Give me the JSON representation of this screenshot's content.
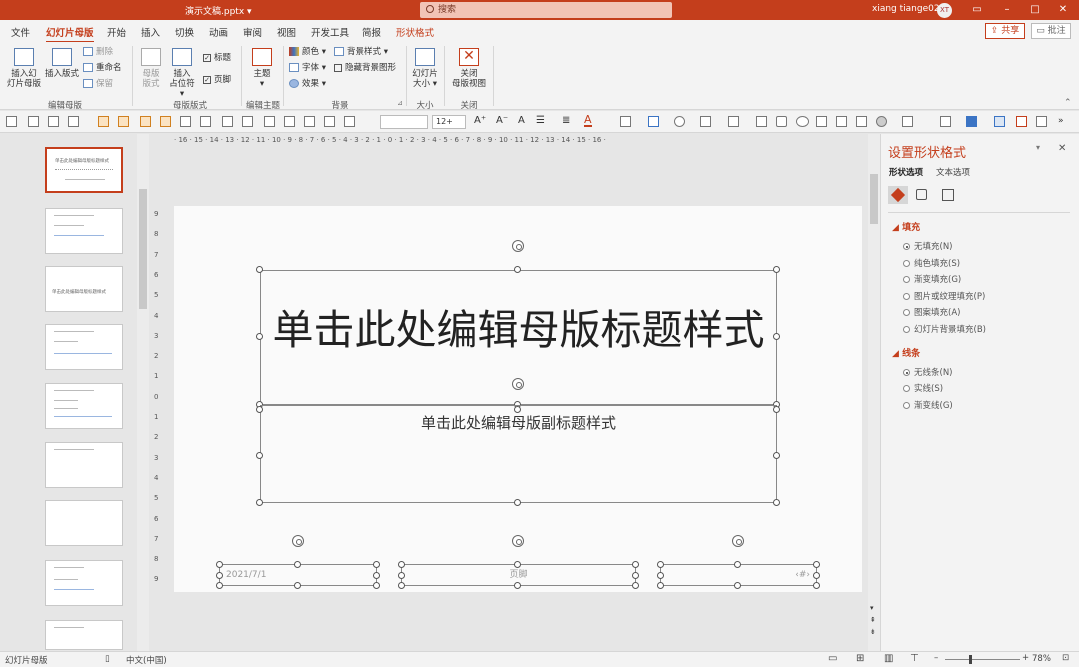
{
  "app": {
    "file_title": "演示文稿.pptx",
    "search_placeholder": "搜索",
    "user_name": "xiang tiange02",
    "user_initials": "XT"
  },
  "menu": {
    "tabs": [
      "文件",
      "幻灯片母版",
      "开始",
      "插入",
      "切换",
      "动画",
      "审阅",
      "视图",
      "开发工具",
      "简报",
      "形状格式"
    ],
    "share": "共享",
    "comment": "批注"
  },
  "ribbon": {
    "insert_master": "插入幻灯片母版",
    "insert_master_l1": "插入幻",
    "insert_master_l2": "灯片母版",
    "insert_layout": "插入版式",
    "delete": "删除",
    "rename": "重命名",
    "preserve": "保留",
    "group_edit_master": "编辑母版",
    "master_layout_l1": "母版",
    "master_layout_l2": "版式",
    "insert_placeholder_l1": "插入",
    "insert_placeholder_l2": "占位符",
    "title_chk": "标题",
    "footer_chk": "页脚",
    "group_master_layout": "母版版式",
    "theme": "主题",
    "group_edit_theme": "编辑主题",
    "colors": "颜色",
    "fonts": "字体",
    "effects": "效果",
    "bg_styles": "背景样式",
    "hide_bg": "隐藏背景图形",
    "group_background": "背景",
    "slide_size_l1": "幻灯片",
    "slide_size_l2": "大小",
    "group_size": "大小",
    "close_l1": "关闭",
    "close_l2": "母版视图",
    "group_close": "关闭"
  },
  "toolbar": {
    "font_size": "12+"
  },
  "rulers": {
    "h": "· 16 · 15 · 14 · 13 · 12 · 11 · 10 · 9 · 8 · 7 · 6 · 5 · 4 · 3 · 2 · 1 · 0 · 1 · 2 · 3 · 4 · 5 · 6 · 7 · 8 · 9 · 10 · 11 · 12 · 13 · 14 · 15 · 16 ·",
    "v": [
      "9",
      "8",
      "7",
      "6",
      "5",
      "4",
      "3",
      "2",
      "1",
      "0",
      "1",
      "2",
      "3",
      "4",
      "5",
      "6",
      "7",
      "8",
      "9"
    ]
  },
  "slide": {
    "title": "单击此处编辑母版标题样式",
    "subtitle": "单击此处编辑母版副标题样式",
    "date": "2021/7/1",
    "footer": "页脚",
    "number": "‹#›"
  },
  "thumbs": {
    "first_title": "单击此处编辑母版标题样式",
    "third_title": "单击此处编辑母版标题样式"
  },
  "pane": {
    "title": "设置形状格式",
    "tab_shape": "形状选项",
    "tab_text": "文本选项",
    "fill_section": "填充",
    "fill_options": [
      "无填充(N)",
      "纯色填充(S)",
      "渐变填充(G)",
      "图片或纹理填充(P)",
      "图案填充(A)",
      "幻灯片背景填充(B)"
    ],
    "line_section": "线条",
    "line_options": [
      "无线条(N)",
      "实线(S)",
      "渐变线(G)"
    ]
  },
  "status": {
    "view": "幻灯片母版",
    "language": "中文(中国)",
    "zoom": "78%"
  },
  "colors": {
    "accent": "#c43e1c"
  }
}
